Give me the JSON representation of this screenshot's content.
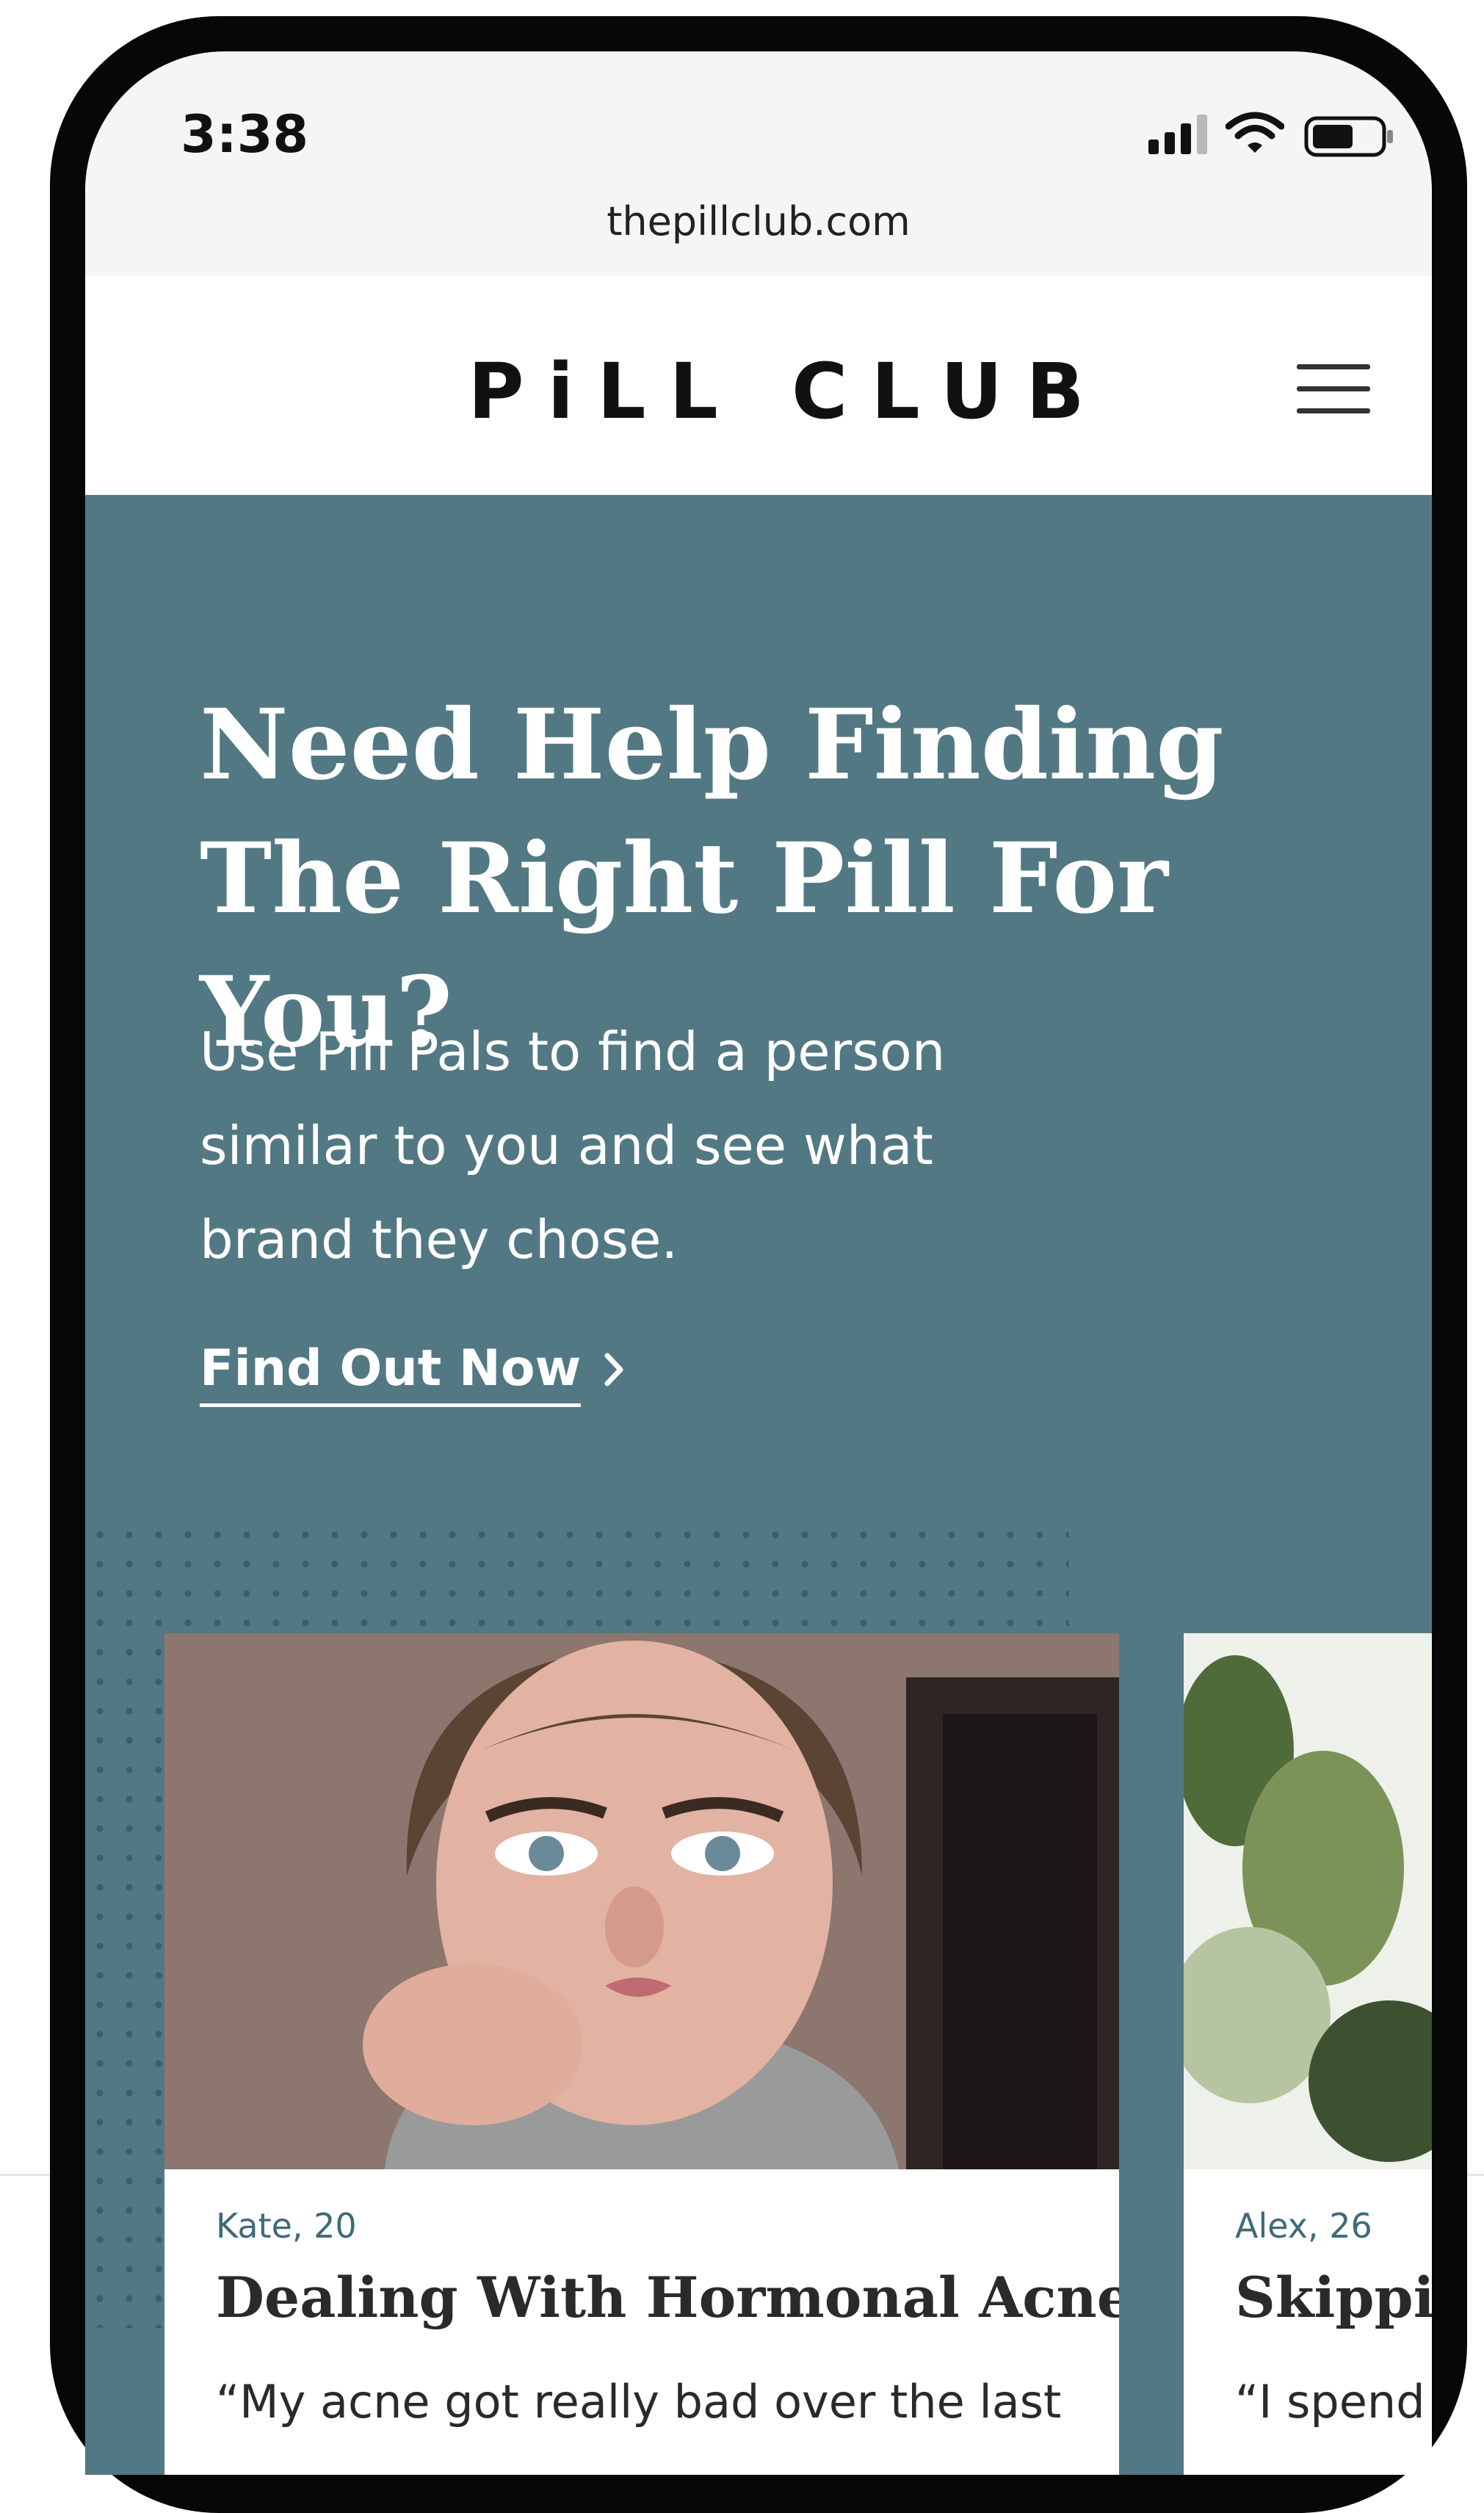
{
  "status_bar": {
    "time": "3:38",
    "url": "thepillclub.com",
    "icons": [
      "signal-icon",
      "wifi-icon",
      "battery-icon"
    ]
  },
  "header": {
    "logo_text": "PiLL CLUB",
    "menu_icon": "hamburger-icon"
  },
  "hero": {
    "title_line1": "Need Help Finding",
    "title_line2": "The Right Pill For You?",
    "text_line1": "Use Pill Pals to find a person",
    "text_line2": "similar to you and see what",
    "text_line3": "brand they chose.",
    "cta_label": "Find Out Now",
    "cta_icon": "chevron-right-icon"
  },
  "cards": [
    {
      "meta": "Kate, 20",
      "title": "Dealing With Hormonal Acne",
      "quote": "“My acne got really bad over the last"
    },
    {
      "meta": "Alex, 26",
      "title": "Skippi",
      "quote": "“I spend"
    }
  ],
  "colors": {
    "hero_bg": "#527883",
    "accent_text": "#3f6a78",
    "header_bg": "#ffffff",
    "status_bg": "#f5f5f5"
  }
}
